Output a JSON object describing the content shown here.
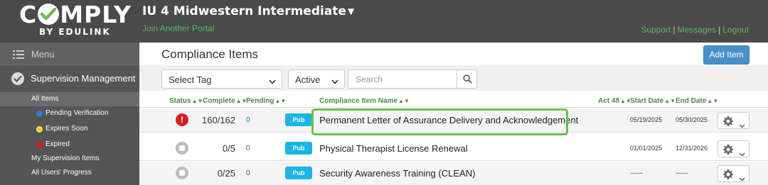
{
  "logo": {
    "brand": "COMPLY",
    "subtitle": "BY EDULINK"
  },
  "header": {
    "portal_title": "IU 4 Midwestern Intermediate",
    "join_link": "Join Another Portal",
    "links": {
      "support": "Support",
      "messages": "Messages",
      "logout": "Logout"
    }
  },
  "sidebar": {
    "menu_label": "Menu",
    "section_label": "Supervision Management",
    "items": [
      {
        "label": "All Items"
      },
      {
        "label": "Pending Verification",
        "dot_color": "#2a7fd4"
      },
      {
        "label": "Expires Soon",
        "dot_color": "#f2c511"
      },
      {
        "label": "Expired",
        "dot_color": "#d42020"
      },
      {
        "label": "My Supervision Items"
      },
      {
        "label": "All Users' Progress"
      }
    ]
  },
  "main": {
    "title": "Compliance Items",
    "add_button": "Add Item",
    "filters": {
      "tag_select": "Select Tag",
      "status_select": "Active",
      "search_placeholder": "Search"
    },
    "columns": {
      "status": "Status",
      "complete": "Complete",
      "pending": "Pending",
      "name": "Compliance Item Name",
      "act48": "Act 48",
      "start_date": "Start Date",
      "end_date": "End Date"
    },
    "rows": [
      {
        "status": "error",
        "status_glyph": "!",
        "complete": "160/162",
        "pending": "0",
        "badge": "Pub",
        "name": "Permanent Letter of Assurance Delivery and Acknowledgement",
        "start_date": "05/19/2025",
        "end_date": "05/30/2025"
      },
      {
        "status": "inactive",
        "complete": "0/5",
        "pending": "0",
        "badge": "Pub",
        "name": "Physical Therapist License Renewal",
        "start_date": "01/01/2025",
        "end_date": "12/31/2026"
      },
      {
        "status": "inactive",
        "complete": "0/25",
        "pending": "0",
        "badge": "Pub",
        "name": "Security Awareness Training (CLEAN)",
        "start_date": "------",
        "end_date": "------"
      }
    ]
  },
  "colors": {
    "header_bg": "#4a4a4a",
    "sidebar_bg": "#555555",
    "accent_green": "#5cb85c",
    "button_blue": "#4a90c8",
    "badge_blue": "#19b6e6",
    "error_red": "#d42020",
    "highlight": "#6abf4b"
  },
  "icons": [
    "check-icon",
    "caret-down-icon",
    "hamburger-icon",
    "check-circle-icon",
    "search-icon",
    "gear-icon",
    "chevron-down-icon"
  ]
}
